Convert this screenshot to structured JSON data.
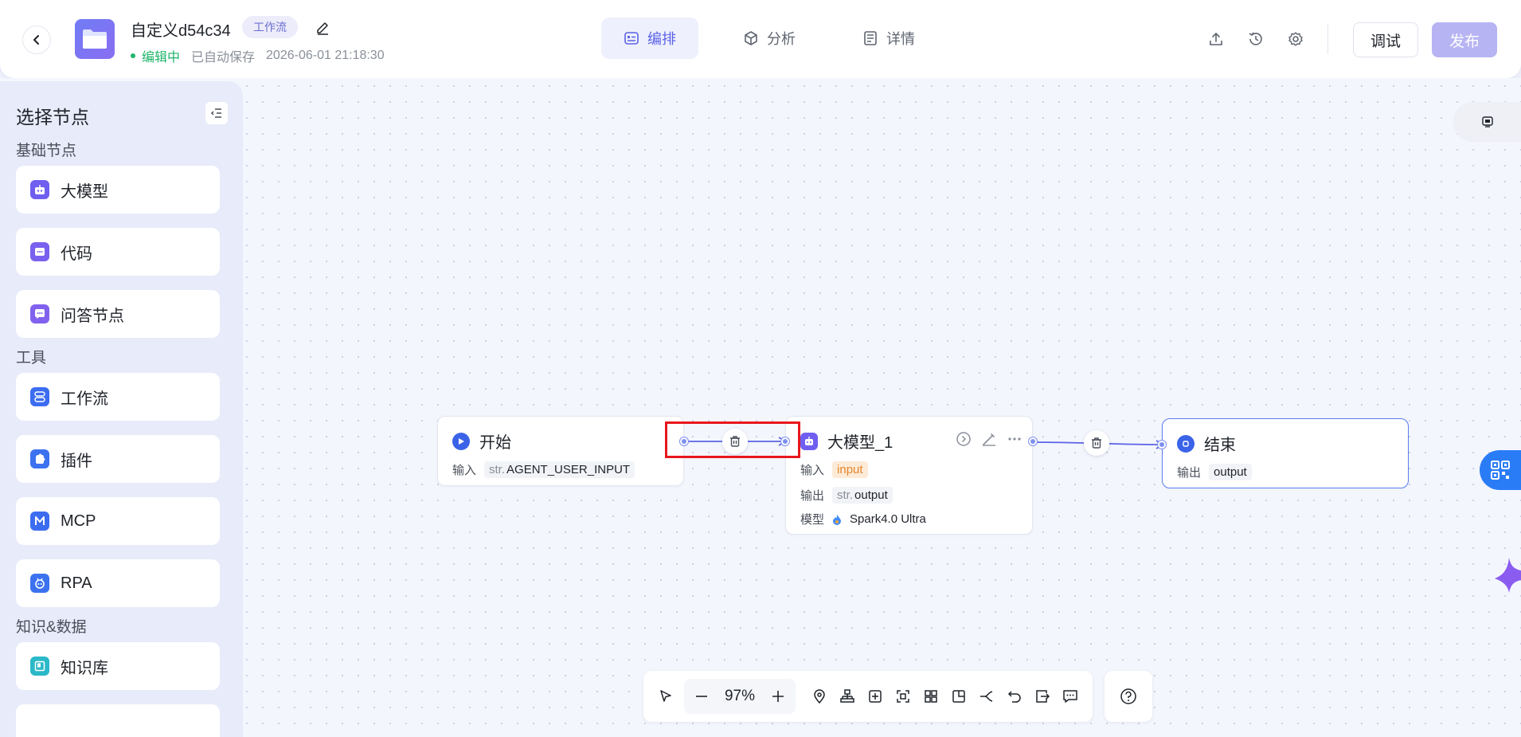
{
  "header": {
    "app_name": "自定义d54c34",
    "type_badge": "工作流",
    "status_editing": "编辑中",
    "status_saved": "已自动保存",
    "status_time": "2026-06-01 21:18:30",
    "tabs": [
      {
        "label": "编排",
        "active": true
      },
      {
        "label": "分析",
        "active": false
      },
      {
        "label": "详情",
        "active": false
      }
    ],
    "debug_label": "调试",
    "publish_label": "发布"
  },
  "sidebar": {
    "title": "选择节点",
    "sections": [
      {
        "label": "基础节点",
        "items": [
          "大模型",
          "代码",
          "问答节点"
        ]
      },
      {
        "label": "工具",
        "items": [
          "工作流",
          "插件",
          "MCP",
          "RPA"
        ]
      },
      {
        "label": "知识&数据",
        "items": [
          "知识库"
        ]
      }
    ]
  },
  "nodes": {
    "start": {
      "title": "开始",
      "input_label": "输入",
      "input_prefix": "str.",
      "input_value": "AGENT_USER_INPUT"
    },
    "llm": {
      "title": "大模型_1",
      "input_label": "输入",
      "input_value": "input",
      "output_label": "输出",
      "output_prefix": "str.",
      "output_value": "output",
      "model_label": "模型",
      "model_value": "Spark4.0 Ultra"
    },
    "end": {
      "title": "结束",
      "output_label": "输出",
      "output_value": "output"
    }
  },
  "toolbar": {
    "zoom": "97%"
  },
  "colors": {
    "accent": "#5b63e6",
    "status_green": "#1eb56a",
    "node_blue": "#3b63e8",
    "highlight_red": "#e8171c",
    "edge": "#5b63e6"
  }
}
